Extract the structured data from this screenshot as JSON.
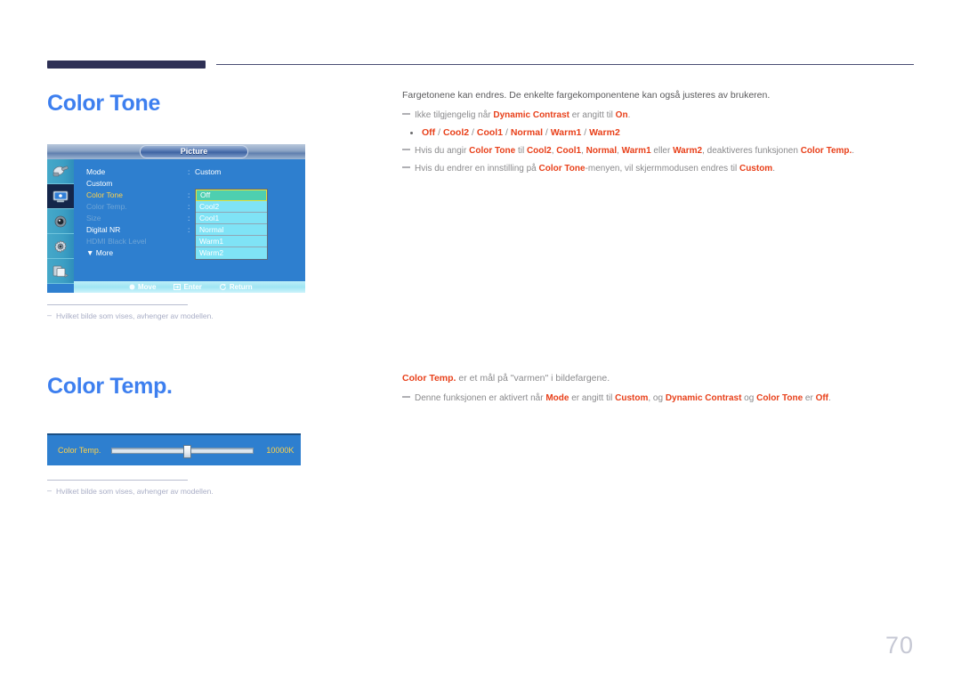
{
  "page_number": "70",
  "sections": [
    {
      "id": "color-tone",
      "heading": "Color Tone",
      "lead": "Fargetonene kan endres. De enkelte fargekomponentene kan også justeres av brukeren.",
      "notes": [
        [
          {
            "t": "Ikke tilgjengelig når ",
            "s": "n"
          },
          {
            "t": "Dynamic Contrast",
            "s": "r"
          },
          {
            "t": " er angitt til ",
            "s": "n"
          },
          {
            "t": "On",
            "s": "r"
          },
          {
            "t": ".",
            "s": "n"
          }
        ],
        [
          {
            "t": "Hvis du angir ",
            "s": "n"
          },
          {
            "t": "Color Tone",
            "s": "r"
          },
          {
            "t": " til ",
            "s": "n"
          },
          {
            "t": "Cool2",
            "s": "r"
          },
          {
            "t": ", ",
            "s": "n"
          },
          {
            "t": "Cool1",
            "s": "r"
          },
          {
            "t": ", ",
            "s": "n"
          },
          {
            "t": "Normal",
            "s": "r"
          },
          {
            "t": ", ",
            "s": "n"
          },
          {
            "t": "Warm1",
            "s": "r"
          },
          {
            "t": " eller ",
            "s": "n"
          },
          {
            "t": "Warm2",
            "s": "r"
          },
          {
            "t": ", deaktiveres funksjonen ",
            "s": "n"
          },
          {
            "t": "Color Temp.",
            "s": "r"
          },
          {
            "t": ".",
            "s": "n"
          }
        ],
        [
          {
            "t": "Hvis du endrer en innstilling på ",
            "s": "n"
          },
          {
            "t": "Color Tone",
            "s": "r"
          },
          {
            "t": "-menyen, vil skjermmodusen endres til ",
            "s": "n"
          },
          {
            "t": "Custom",
            "s": "r"
          },
          {
            "t": ".",
            "s": "n"
          }
        ]
      ],
      "bullet": [
        {
          "t": "Off",
          "s": "r"
        },
        {
          "t": " / ",
          "s": "n"
        },
        {
          "t": "Cool2",
          "s": "r"
        },
        {
          "t": " / ",
          "s": "n"
        },
        {
          "t": "Cool1",
          "s": "r"
        },
        {
          "t": " / ",
          "s": "n"
        },
        {
          "t": "Normal",
          "s": "r"
        },
        {
          "t": " / ",
          "s": "n"
        },
        {
          "t": "Warm1",
          "s": "r"
        },
        {
          "t": " / ",
          "s": "n"
        },
        {
          "t": "Warm2",
          "s": "r"
        }
      ]
    },
    {
      "id": "color-temp",
      "heading": "Color Temp.",
      "lead_rich": [
        {
          "t": "Color Temp.",
          "s": "r"
        },
        {
          "t": " er et mål på \"varmen\" i bildefargene.",
          "s": "n"
        }
      ],
      "notes": [
        [
          {
            "t": "Denne funksjonen er aktivert når ",
            "s": "n"
          },
          {
            "t": "Mode",
            "s": "r"
          },
          {
            "t": " er angitt til ",
            "s": "n"
          },
          {
            "t": "Custom",
            "s": "r"
          },
          {
            "t": ", og ",
            "s": "n"
          },
          {
            "t": "Dynamic Contrast",
            "s": "r"
          },
          {
            "t": " og ",
            "s": "n"
          },
          {
            "t": "Color Tone",
            "s": "r"
          },
          {
            "t": " er ",
            "s": "n"
          },
          {
            "t": "Off",
            "s": "r"
          },
          {
            "t": ".",
            "s": "n"
          }
        ]
      ]
    }
  ],
  "osd": {
    "title": "Picture",
    "sidebar_icons": [
      "input-source-icon",
      "picture-icon",
      "sound-icon",
      "system-setup-icon",
      "multi-control-icon"
    ],
    "selected_sidebar_index": 1,
    "menu_items": [
      {
        "label": "Mode",
        "state": "normal",
        "colon": true,
        "value": "Custom"
      },
      {
        "label": "Custom",
        "state": "normal",
        "colon": false,
        "value": ""
      },
      {
        "label": "Color Tone",
        "state": "highlight",
        "colon": true,
        "value": ""
      },
      {
        "label": "Color Temp.",
        "state": "dim",
        "colon": true,
        "value": ""
      },
      {
        "label": "Size",
        "state": "dim",
        "colon": true,
        "value": ""
      },
      {
        "label": "Digital NR",
        "state": "normal",
        "colon": true,
        "value": ""
      },
      {
        "label": "HDMI Black Level",
        "state": "dim",
        "colon": false,
        "value": ""
      },
      {
        "label": "▼ More",
        "state": "normal",
        "colon": false,
        "value": ""
      }
    ],
    "dropdown_options": [
      "Off",
      "Cool2",
      "Cool1",
      "Normal",
      "Warm1",
      "Warm2"
    ],
    "dropdown_selected": "Off",
    "footer": {
      "move": "Move",
      "enter": "Enter",
      "return": "Return"
    }
  },
  "slider": {
    "label": "Color Temp.",
    "value": "10000K",
    "knob_percent": 50
  },
  "footnotes": {
    "image_varies": "Hvilket bilde som vises, avhenger av modellen."
  },
  "colors": {
    "heading_blue": "#3d7fef",
    "accent_red": "#e8401a",
    "osd_blue": "#2e7fcf",
    "osd_gold": "#ffd24a",
    "rule_navy": "#2e3055"
  }
}
